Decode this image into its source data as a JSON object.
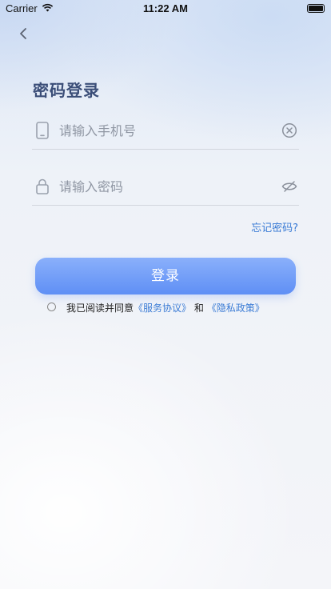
{
  "status_bar": {
    "carrier": "Carrier",
    "time": "11:22 AM"
  },
  "header": {
    "title": "密码登录"
  },
  "form": {
    "phone": {
      "placeholder": "请输入手机号",
      "value": ""
    },
    "password": {
      "placeholder": "请输入密码",
      "value": ""
    },
    "forgot_label": "忘记密码?",
    "login_label": "登录"
  },
  "agreement": {
    "checked": false,
    "prefix": "我已阅读并同意",
    "service_link": "《服务协议》",
    "conjunction": "和",
    "privacy_link": "《隐私政策》"
  },
  "colors": {
    "accent": "#3a7bd5",
    "button_start": "#8ab0fb",
    "button_end": "#5f8ff5",
    "title": "#3b4e78"
  },
  "icons": {
    "back": "chevron-left-icon",
    "phone": "phone-icon",
    "lock": "lock-icon",
    "clear": "clear-circle-x-icon",
    "toggle_password": "eye-off-icon"
  }
}
